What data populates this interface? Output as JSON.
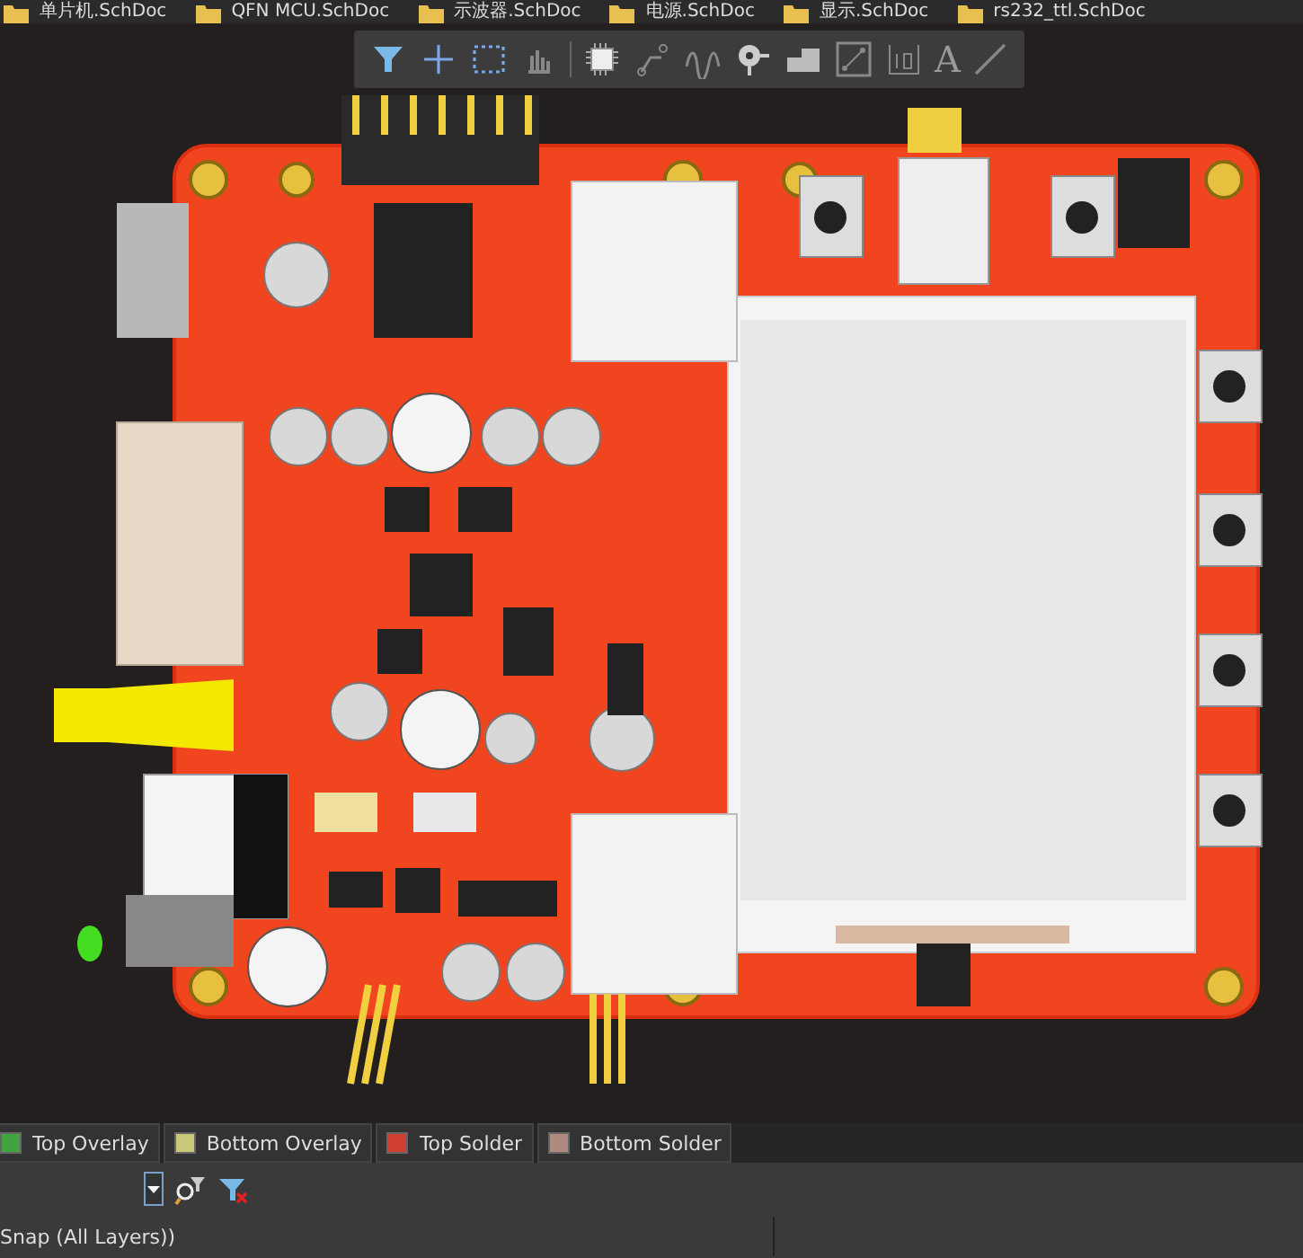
{
  "document_tabs": [
    {
      "label": "单片机.SchDoc"
    },
    {
      "label": "QFN MCU.SchDoc"
    },
    {
      "label": "示波器.SchDoc"
    },
    {
      "label": "电源.SchDoc"
    },
    {
      "label": "显示.SchDoc"
    },
    {
      "label": "rs232_ttl.SchDoc"
    }
  ],
  "toolbar": [
    {
      "kind": "filter"
    },
    {
      "kind": "cross"
    },
    {
      "kind": "select"
    },
    {
      "kind": "bars"
    },
    {
      "kind": "chip"
    },
    {
      "kind": "route"
    },
    {
      "kind": "wave"
    },
    {
      "kind": "pin"
    },
    {
      "kind": "step"
    },
    {
      "kind": "box"
    },
    {
      "kind": "dim"
    },
    {
      "kind": "text",
      "text": "A"
    },
    {
      "kind": "line"
    }
  ],
  "layer_tabs": [
    {
      "label": "Top Overlay",
      "color": "#3fa33f"
    },
    {
      "label": "Bottom Overlay",
      "color": "#c8c878"
    },
    {
      "label": "Top Solder",
      "color": "#d04030"
    },
    {
      "label": "Bottom Solder",
      "color": "#b08a80"
    }
  ],
  "status_bar": {
    "text": "Snap (All Layers))"
  }
}
